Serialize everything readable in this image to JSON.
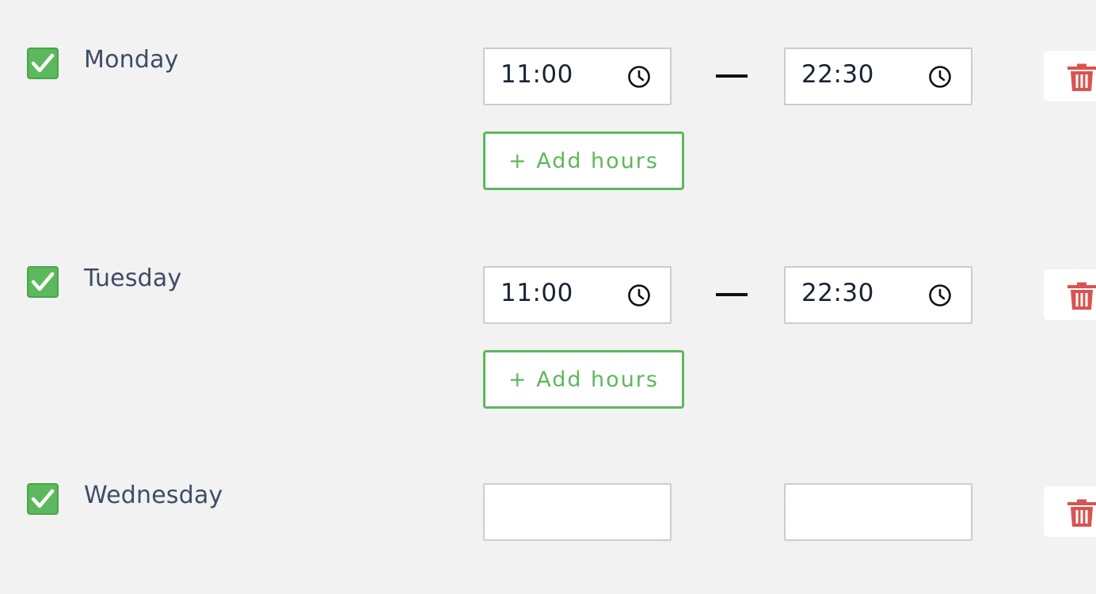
{
  "schedule": {
    "add_hours_label": "+ Add hours",
    "check_color": "#5cb85c",
    "delete_color": "#d9534f",
    "days": [
      {
        "name": "Monday",
        "checked": true,
        "start": "11:00",
        "end": "22:30"
      },
      {
        "name": "Tuesday",
        "checked": true,
        "start": "11:00",
        "end": "22:30"
      },
      {
        "name": "Wednesday",
        "checked": true,
        "start": "",
        "end": ""
      }
    ],
    "icons": {
      "checkbox": "checkmark-icon",
      "time": "clock-icon",
      "delete": "trash-icon",
      "separator": "dash"
    }
  }
}
